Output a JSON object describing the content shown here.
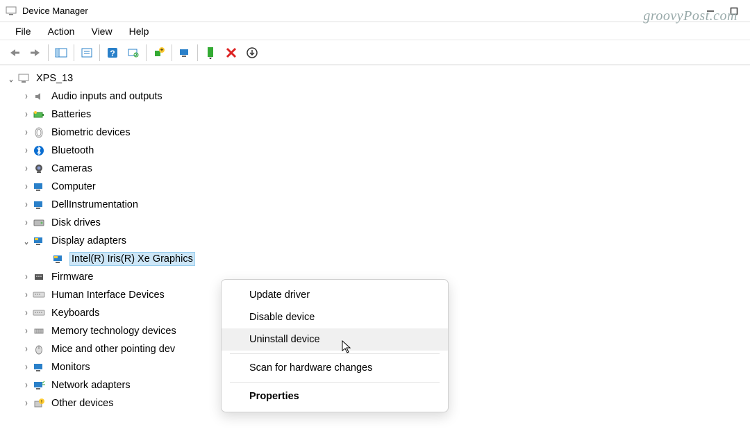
{
  "titlebar": {
    "title": "Device Manager"
  },
  "menubar": {
    "file": "File",
    "action": "Action",
    "view": "View",
    "help": "Help"
  },
  "tree": {
    "root": "XPS_13",
    "items": [
      "Audio inputs and outputs",
      "Batteries",
      "Biometric devices",
      "Bluetooth",
      "Cameras",
      "Computer",
      "DellInstrumentation",
      "Disk drives",
      "Display adapters",
      "Firmware",
      "Human Interface Devices",
      "Keyboards",
      "Memory technology devices",
      "Mice and other pointing dev",
      "Monitors",
      "Network adapters",
      "Other devices"
    ],
    "selected_child": "Intel(R) Iris(R) Xe Graphics"
  },
  "context_menu": {
    "update": "Update driver",
    "disable": "Disable device",
    "uninstall": "Uninstall device",
    "scan": "Scan for hardware changes",
    "properties": "Properties"
  },
  "watermark": "groovyPost.com",
  "icons": {
    "audio": "speaker-icon",
    "batteries": "battery-icon",
    "biometric": "fingerprint-icon",
    "bluetooth": "bluetooth-icon",
    "cameras": "camera-icon",
    "computer": "computer-icon",
    "dell": "chip-icon",
    "disk": "disk-icon",
    "display": "display-icon",
    "firmware": "firmware-icon",
    "hid": "hid-icon",
    "keyboards": "keyboard-icon",
    "memory": "memory-icon",
    "mice": "mouse-icon",
    "monitors": "monitor-icon",
    "network": "network-icon",
    "other": "other-icon"
  }
}
